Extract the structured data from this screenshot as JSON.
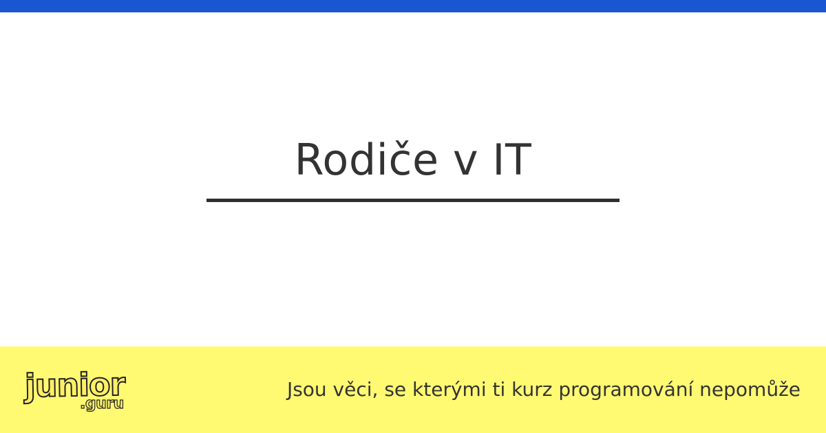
{
  "title": "Rodiče v IT",
  "footer": {
    "logo": {
      "word": "junior",
      "suffix": ".guru"
    },
    "tagline": "Jsou věci, se kterými ti kurz programování nepomůže"
  },
  "colors": {
    "top_bar": "#1a56d1",
    "background": "#ffffff",
    "footer_bg": "#fffa72",
    "title_text": "#333333",
    "underline": "#2f2f2f"
  }
}
